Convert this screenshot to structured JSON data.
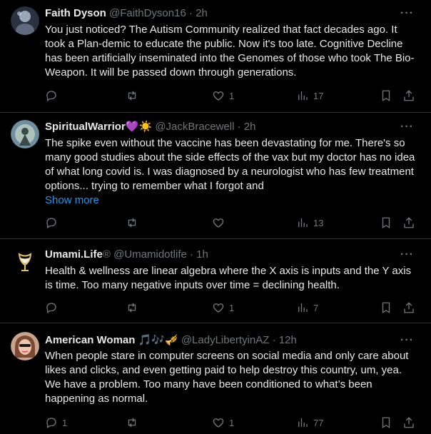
{
  "tweets": [
    {
      "name": "Faith Dyson",
      "name_suffix": "",
      "handle_time": "@FaithDyson16 · 2h",
      "body": "You just noticed? The Autism Community realized that fact decades ago. It took a Plan-demic to educate the public. Now it's too late. Cognitive Decline has been artificially inseminated into the Genomes of those who took The Bio-Weapon. It will be passed down through generations.",
      "show_more": "",
      "replies": "",
      "retweets": "",
      "likes": "1",
      "views": "17"
    },
    {
      "name": "SpiritualWarrior",
      "name_suffix": "💜☀️",
      "handle_time": "@JackBracewell · 2h",
      "body": "The spike even without the vaccine has been devastating for me. There's so many good studies about the side effects of the vax but my doctor has no idea of what long covid is. I was diagnosed by a neurologist who has few treatment options... trying to remember what I forgot and",
      "show_more": "Show more",
      "replies": "",
      "retweets": "",
      "likes": "",
      "views": "13"
    },
    {
      "name": "Umami.Life",
      "name_suffix": "®",
      "handle_time": "@Umamidotlife · 1h",
      "body": "Health & wellness are linear algebra where the X axis is inputs and the Y axis is time. Too many negative inputs over time = declining health.",
      "show_more": "",
      "replies": "",
      "retweets": "",
      "likes": "1",
      "views": "7"
    },
    {
      "name": "American Woman",
      "name_suffix": "🎵🎶🎺",
      "handle_time": "@LadyLibertyinAZ · 12h",
      "body": "When people stare in computer screens on social media and only care about likes and clicks, and even getting paid to help destroy this country, um, yea. We have a problem. Too many have been conditioned to what’s been happening as normal.",
      "show_more": "",
      "replies": "1",
      "retweets": "",
      "likes": "1",
      "views": "77"
    }
  ],
  "more_glyph": "···",
  "colors": {
    "background": "#000000",
    "text": "#e7e9ea",
    "muted": "#71767b",
    "link": "#1d9bf0",
    "divider": "#2f3336"
  },
  "icons": [
    "reply-icon",
    "retweet-icon",
    "like-icon",
    "views-icon",
    "bookmark-icon",
    "share-icon",
    "more-icon"
  ]
}
